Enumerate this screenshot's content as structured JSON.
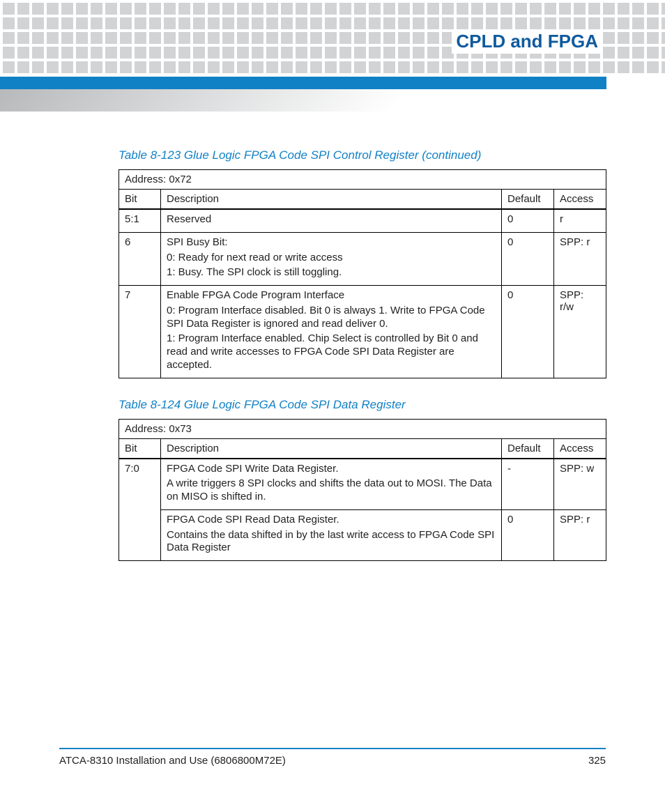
{
  "header": {
    "section_title": "CPLD and FPGA"
  },
  "table1": {
    "caption": "Table 8-123 Glue Logic FPGA Code SPI Control Register (continued)",
    "address": "Address: 0x72",
    "cols": {
      "bit": "Bit",
      "desc": "Description",
      "def": "Default",
      "acc": "Access"
    },
    "rows": [
      {
        "bit": "5:1",
        "desc": [
          "Reserved"
        ],
        "def": "0",
        "acc": "r"
      },
      {
        "bit": "6",
        "desc": [
          "SPI Busy Bit:",
          "0: Ready for next read or write access",
          "1: Busy. The SPI clock is still toggling."
        ],
        "def": "0",
        "acc": "SPP: r"
      },
      {
        "bit": "7",
        "desc": [
          "Enable FPGA Code Program Interface",
          "0: Program Interface disabled. Bit 0 is always 1. Write to FPGA Code SPI Data Register is ignored and read deliver 0.",
          "1: Program Interface enabled. Chip Select is controlled by Bit 0 and read and write accesses to FPGA Code SPI Data Register are accepted."
        ],
        "def": "0",
        "acc": "SPP: r/w"
      }
    ]
  },
  "table2": {
    "caption": "Table 8-124 Glue Logic FPGA Code SPI Data Register",
    "address": "Address: 0x73",
    "cols": {
      "bit": "Bit",
      "desc": "Description",
      "def": "Default",
      "acc": "Access"
    },
    "rows": [
      {
        "bit": "7:0",
        "desc": [
          "FPGA Code SPI Write Data Register.",
          "A write triggers 8 SPI clocks and shifts the data out to MOSI. The Data on MISO is shifted in."
        ],
        "def": "-",
        "acc": "SPP: w"
      },
      {
        "bit": "",
        "desc": [
          "FPGA Code SPI Read Data Register.",
          "Contains the data shifted in by the last write access to FPGA Code SPI Data Register"
        ],
        "def": "0",
        "acc": "SPP: r"
      }
    ]
  },
  "footer": {
    "doc": "ATCA-8310 Installation and Use (6806800M72E)",
    "page": "325"
  }
}
